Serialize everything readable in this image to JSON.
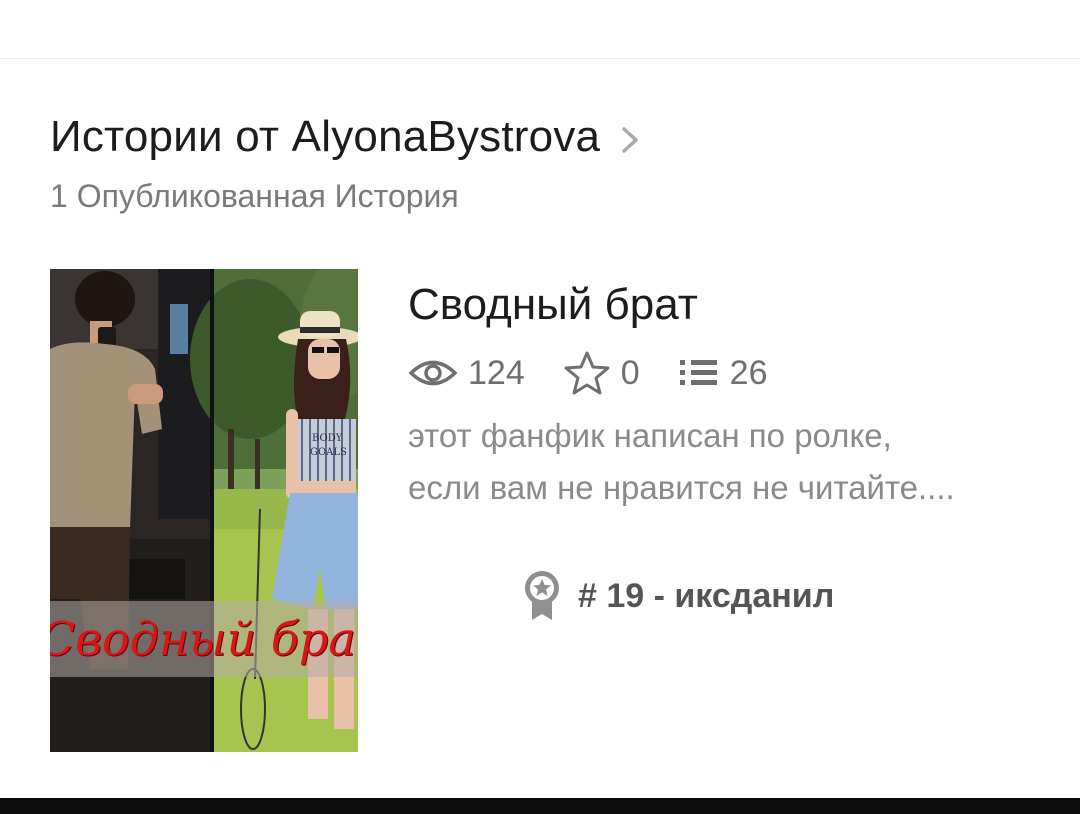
{
  "section": {
    "title": "Истории от AlyonaBystrova",
    "subtitle": "1 Опубликованная История"
  },
  "story": {
    "cover_title": "Сводный брат",
    "title": "Сводный брат",
    "reads": "124",
    "votes": "0",
    "parts": "26",
    "description": "этот фанфик написан по ролке, если вам не нравится не читайте....",
    "rank": "# 19 - иксданил",
    "shirt_text_1": "BODY",
    "shirt_text_2": "GOALS"
  },
  "icons": {
    "header_chevron": "chevron-right-icon",
    "reads": "eye-icon",
    "votes": "star-icon",
    "parts": "list-icon",
    "rank": "award-ribbon-icon"
  },
  "colors": {
    "title_text": "#1c1c1c",
    "secondary_text": "#7a7a7a",
    "stat_icon": "#6f6f6f",
    "rank_badge": "#8f8f8f",
    "cover_title": "#d91515"
  }
}
